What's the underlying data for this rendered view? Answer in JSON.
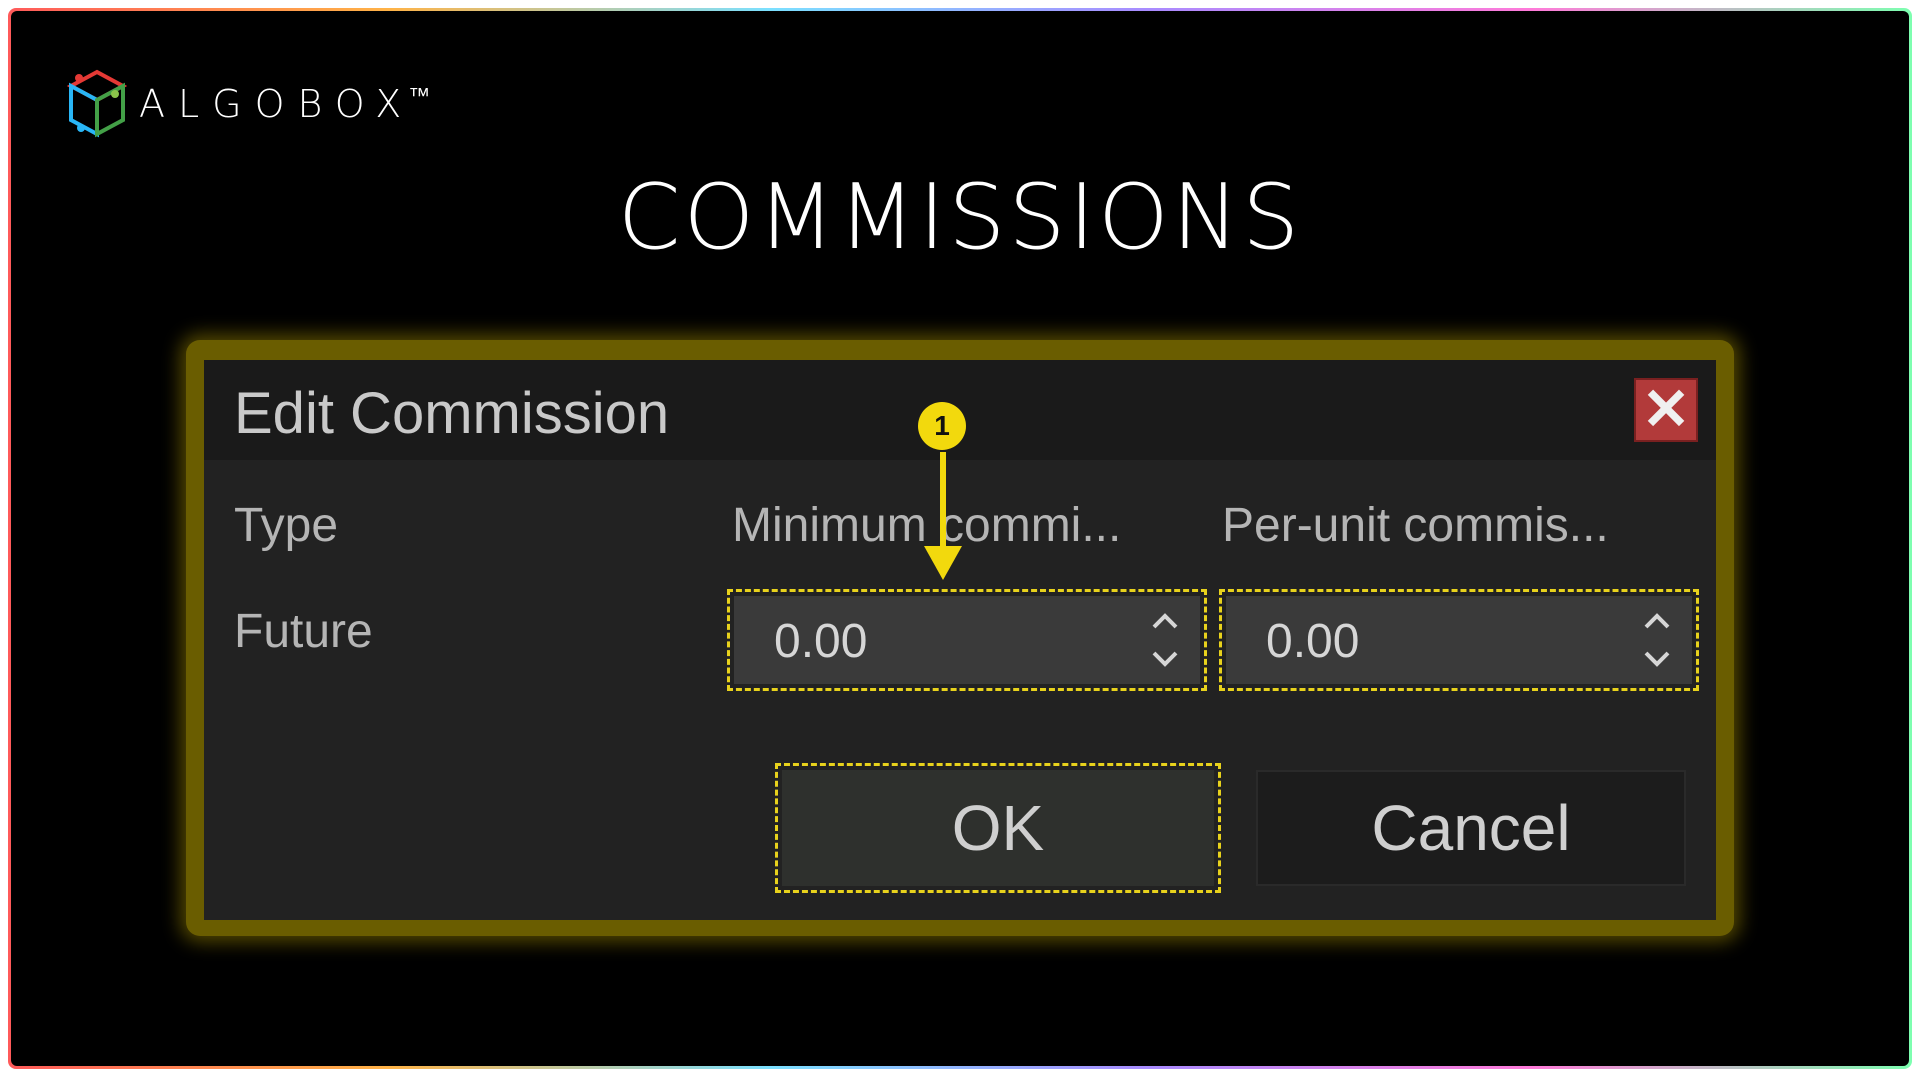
{
  "brand": {
    "name": "ALGOBOX",
    "trademark": "™"
  },
  "page": {
    "title": "COMMISSIONS"
  },
  "dialog": {
    "title": "Edit Commission",
    "close_icon": "close-icon",
    "columns": {
      "type": "Type",
      "minimum": "Minimum commi...",
      "per_unit": "Per-unit commis..."
    },
    "row": {
      "type": "Future",
      "minimum_value": "0.00",
      "per_unit_value": "0.00"
    },
    "buttons": {
      "ok": "OK",
      "cancel": "Cancel"
    }
  },
  "annotation": {
    "marker": "1"
  },
  "colors": {
    "highlight": "#e8d21c",
    "close_button": "#b23a3a",
    "background": "#000000",
    "dialog": "#222222"
  }
}
